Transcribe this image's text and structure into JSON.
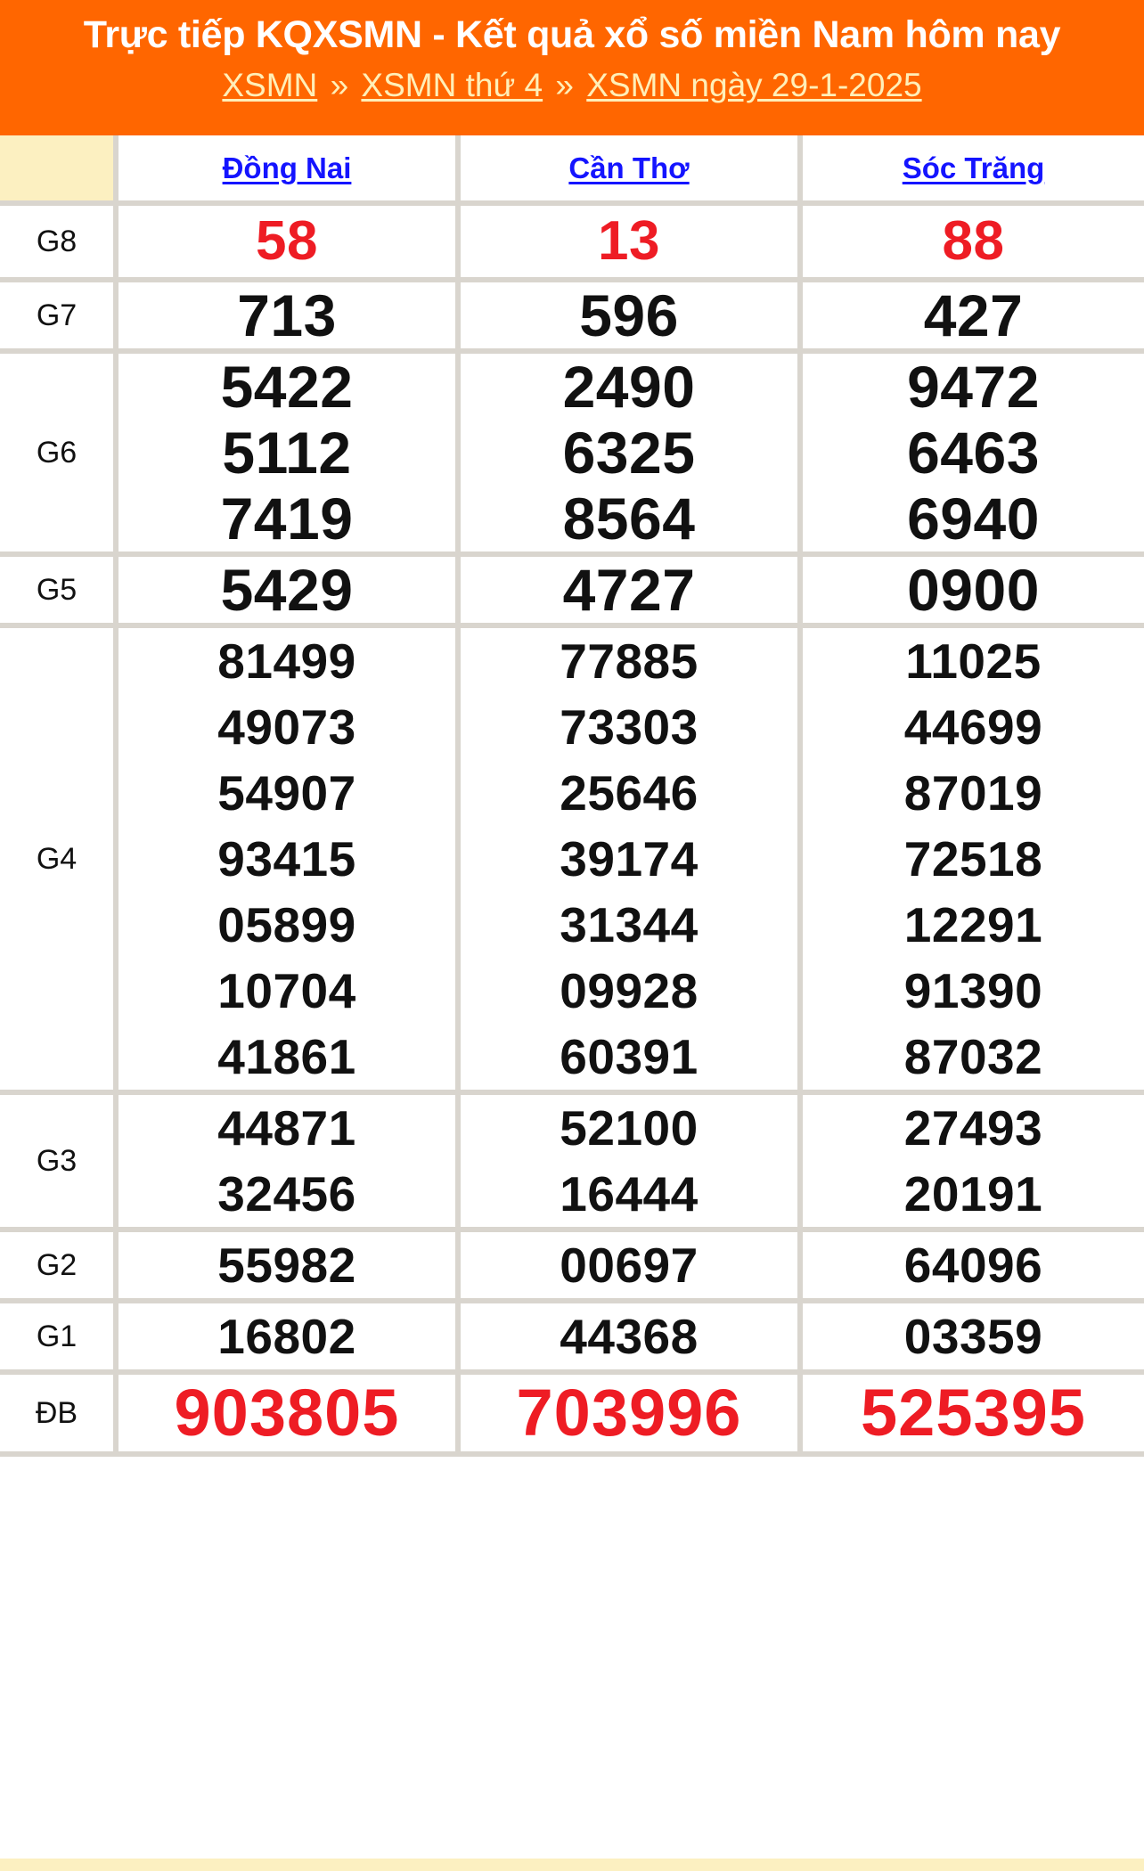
{
  "header": {
    "title": "Trực tiếp KQXSMN - Kết quả xổ số miền Nam hôm nay",
    "breadcrumb": {
      "item1": "XSMN",
      "sep1": "»",
      "item2": "XSMN thứ 4",
      "sep2": "»",
      "item3": "XSMN ngày 29-1-2025"
    },
    "colors": {
      "banner_bg": "#ff6600",
      "title_text": "#ffffff",
      "breadcrumb_text": "#ffefb8"
    }
  },
  "table": {
    "colors": {
      "header_bg": "#fcf0c1",
      "grid": "#d9d5ce",
      "prize_highlight": "#ee1c24",
      "province_link": "#1414ff"
    },
    "corner_label": "",
    "provinces": [
      "Đồng Nai",
      "Cần Thơ",
      "Sóc Trăng"
    ],
    "rows": [
      {
        "label": "G8",
        "highlight": true,
        "values": [
          [
            "58"
          ],
          [
            "13"
          ],
          [
            "88"
          ]
        ]
      },
      {
        "label": "G7",
        "highlight": false,
        "values": [
          [
            "713"
          ],
          [
            "596"
          ],
          [
            "427"
          ]
        ]
      },
      {
        "label": "G6",
        "highlight": false,
        "values": [
          [
            "5422",
            "5112",
            "7419"
          ],
          [
            "2490",
            "6325",
            "8564"
          ],
          [
            "9472",
            "6463",
            "6940"
          ]
        ]
      },
      {
        "label": "G5",
        "highlight": false,
        "values": [
          [
            "5429"
          ],
          [
            "4727"
          ],
          [
            "0900"
          ]
        ]
      },
      {
        "label": "G4",
        "highlight": false,
        "values": [
          [
            "81499",
            "49073",
            "54907",
            "93415",
            "05899",
            "10704",
            "41861"
          ],
          [
            "77885",
            "73303",
            "25646",
            "39174",
            "31344",
            "09928",
            "60391"
          ],
          [
            "11025",
            "44699",
            "87019",
            "72518",
            "12291",
            "91390",
            "87032"
          ]
        ]
      },
      {
        "label": "G3",
        "highlight": false,
        "values": [
          [
            "44871",
            "32456"
          ],
          [
            "52100",
            "16444"
          ],
          [
            "27493",
            "20191"
          ]
        ]
      },
      {
        "label": "G2",
        "highlight": false,
        "values": [
          [
            "55982"
          ],
          [
            "00697"
          ],
          [
            "64096"
          ]
        ]
      },
      {
        "label": "G1",
        "highlight": false,
        "values": [
          [
            "16802"
          ],
          [
            "44368"
          ],
          [
            "03359"
          ]
        ]
      },
      {
        "label": "ĐB",
        "highlight": true,
        "values": [
          [
            "903805"
          ],
          [
            "703996"
          ],
          [
            "525395"
          ]
        ]
      }
    ]
  }
}
